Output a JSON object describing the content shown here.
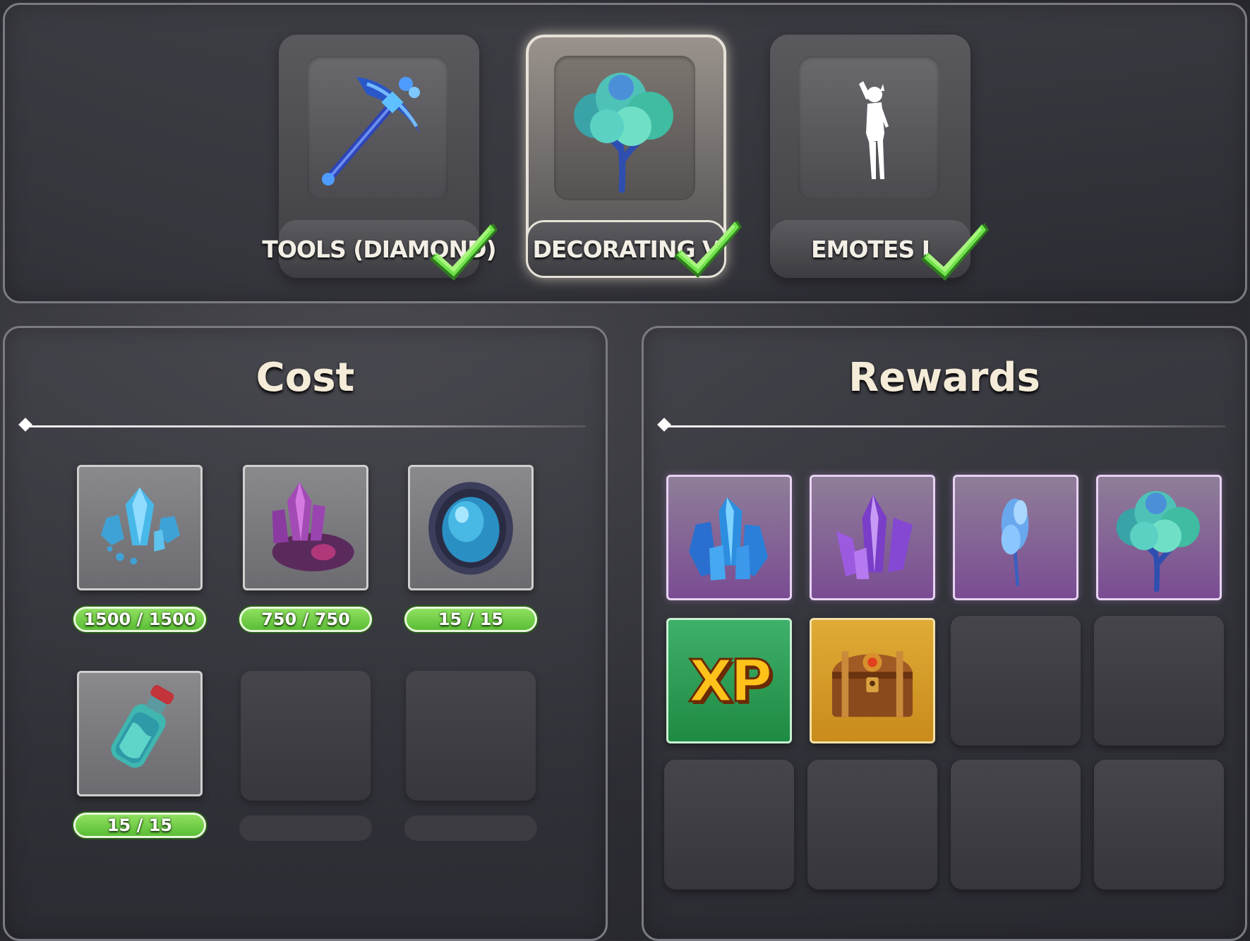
{
  "unlocks": [
    {
      "label": "TOOLS (DIAMOND)",
      "icon": "diamond-pickaxe-icon",
      "completed": true,
      "selected": false
    },
    {
      "label": "DECORATING V",
      "icon": "crystal-tree-icon",
      "completed": true,
      "selected": true
    },
    {
      "label": "EMOTES I",
      "icon": "emote-silhouette-icon",
      "completed": true,
      "selected": false
    }
  ],
  "cost": {
    "title": "Cost",
    "items": [
      {
        "icon": "blue-crystal-shards-icon",
        "amount": "1500 / 1500"
      },
      {
        "icon": "purple-crystal-ore-icon",
        "amount": "750 / 750"
      },
      {
        "icon": "blue-gem-stone-icon",
        "amount": "15 / 15"
      },
      {
        "icon": "potion-bottle-icon",
        "amount": "15 / 15"
      }
    ]
  },
  "rewards": {
    "title": "Rewards",
    "items": [
      {
        "icon": "blue-crystal-cluster-icon",
        "rarity": "purple"
      },
      {
        "icon": "purple-crystal-cluster-icon",
        "rarity": "purple"
      },
      {
        "icon": "blue-sapling-icon",
        "rarity": "purple"
      },
      {
        "icon": "crystal-tree-icon",
        "rarity": "purple"
      },
      {
        "icon": "xp-icon",
        "label": "XP",
        "rarity": "green"
      },
      {
        "icon": "treasure-chest-icon",
        "rarity": "gold"
      }
    ]
  },
  "colors": {
    "progress_complete": "#6fcf43",
    "rarity_purple": "#7a4c93",
    "rarity_green": "#1e8a42",
    "rarity_gold": "#c88b1c",
    "check": "#4cd137"
  }
}
